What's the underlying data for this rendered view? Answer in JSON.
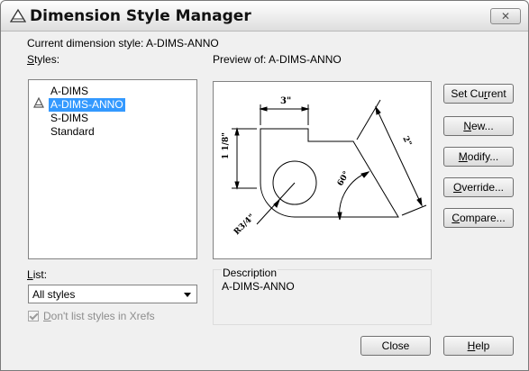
{
  "window": {
    "title": "Dimension Style Manager",
    "close_label": "✕"
  },
  "current_style": {
    "label": "Current dimension style: A-DIMS-ANNO"
  },
  "styles": {
    "label": "Styles:",
    "label_mnemonic": "S",
    "label_rest": "tyles:",
    "items": [
      {
        "label": "A-DIMS"
      },
      {
        "label": "A-DIMS-ANNO",
        "selected": true,
        "annotative": true
      },
      {
        "label": "S-DIMS"
      },
      {
        "label": "Standard"
      }
    ]
  },
  "preview": {
    "label": "Preview of: A-DIMS-ANNO",
    "dims": {
      "top": "3\"",
      "left": "1 1/8\"",
      "right": "2\"",
      "angle": "60°",
      "radius": "R3/4\""
    }
  },
  "buttons": {
    "set_current": {
      "pre": "Set Cu",
      "mn": "r",
      "post": "rent"
    },
    "new": {
      "pre": "",
      "mn": "N",
      "post": "ew..."
    },
    "modify": {
      "pre": "",
      "mn": "M",
      "post": "odify..."
    },
    "override": {
      "pre": "",
      "mn": "O",
      "post": "verride..."
    },
    "compare": {
      "pre": "",
      "mn": "C",
      "post": "ompare..."
    },
    "close": "Close",
    "help": {
      "pre": "",
      "mn": "H",
      "post": "elp"
    }
  },
  "list": {
    "label_mn": "L",
    "label_rest": "ist:",
    "selected": "All styles"
  },
  "xrefs_checkbox": {
    "checked": true,
    "mn": "D",
    "rest": "on't list styles in Xrefs"
  },
  "description": {
    "label": "Description",
    "text": "A-DIMS-ANNO"
  },
  "colors": {
    "selection": "#3399ff",
    "window_bg": "#f0f0f0"
  }
}
